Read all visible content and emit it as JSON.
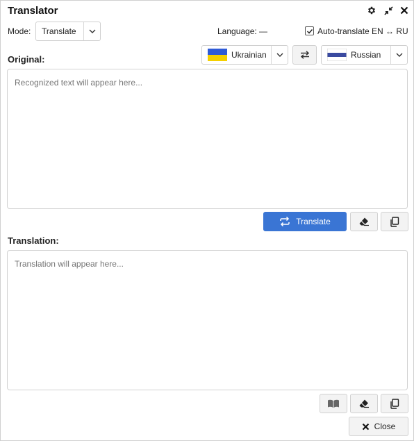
{
  "window": {
    "title": "Translator"
  },
  "mode": {
    "label": "Mode:",
    "value": "Translate"
  },
  "language": {
    "label": "Language: —"
  },
  "auto_translate": {
    "label": "Auto-translate EN ↔ RU",
    "checked": true
  },
  "original": {
    "label": "Original:",
    "placeholder": "Recognized text will appear here..."
  },
  "source_lang": {
    "value": "Ukrainian",
    "flag_colors": [
      "#2f5bd7",
      "#f5d000"
    ]
  },
  "target_lang": {
    "value": "Russian",
    "flag_colors": [
      "#ffffff",
      "#3a4aa0",
      "#ffffff"
    ]
  },
  "actions": {
    "translate_label": "Translate",
    "close_label": "Close"
  },
  "translation": {
    "label": "Translation:",
    "placeholder": "Translation will appear here..."
  },
  "colors": {
    "accent": "#3a75d4"
  }
}
